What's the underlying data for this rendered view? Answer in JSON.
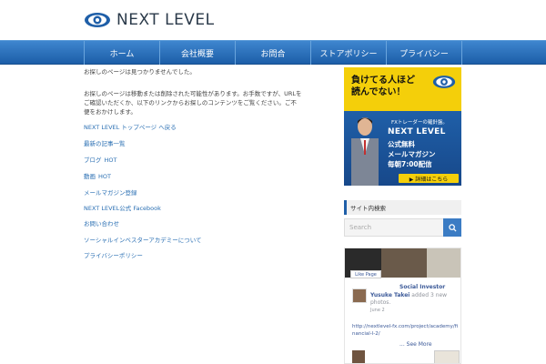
{
  "header": {
    "logo_text": "NEXT LEVEL"
  },
  "nav": {
    "items": [
      {
        "label": "ホーム"
      },
      {
        "label": "会社概要"
      },
      {
        "label": "お問合"
      },
      {
        "label": "ストアポリシー"
      },
      {
        "label": "プライバシー"
      }
    ]
  },
  "main": {
    "p1": "お探しのページは見つかりませんでした。",
    "p2": "お探しのページは移動または削除された可能性があります。お手数ですが、URLをご確認いただくか、以下のリンクからお探しのコンテンツをご覧ください。ご不便をおかけします。",
    "links": [
      {
        "label": "NEXT LEVEL トップページ へ戻る"
      },
      {
        "label": "最新の記事一覧"
      },
      {
        "label": "ブログ",
        "badge": "HOT"
      },
      {
        "label": "動画",
        "badge": "HOT"
      },
      {
        "label": "メールマガジン登録"
      },
      {
        "label": "NEXT LEVEL公式 Facebook"
      },
      {
        "label": "お問い合わせ"
      },
      {
        "label": "ソーシャルインベスターアカデミーについて"
      },
      {
        "label": "プライバシーポリシー"
      }
    ]
  },
  "banner": {
    "headline_1": "負けてる人ほど",
    "headline_2": "読んでない！",
    "sub": "FXトレーダーの羅針盤。",
    "brand": "NEXT LEVEL",
    "line1": "公式無料",
    "line2": "メールマガジン",
    "line3": "毎朝7:00配信",
    "cta": "▶ 詳細はこちら"
  },
  "sidebar": {
    "widget_title": "サイト内検索",
    "search_placeholder": "Search"
  },
  "facebook": {
    "like_label": "Like Page",
    "page_name": "Social Investor",
    "author": "Yusuke Takei",
    "action": "added 3 new photos.",
    "time": "June 2",
    "link": "http://nextlevel-fx.com/project/academy/financial-l-2/",
    "see_more": "... See More"
  },
  "colors": {
    "nav_blue": "#1c5ea8",
    "link_blue": "#2a6fb3",
    "banner_yellow": "#f4cf0a",
    "facebook_blue": "#3b5998"
  }
}
